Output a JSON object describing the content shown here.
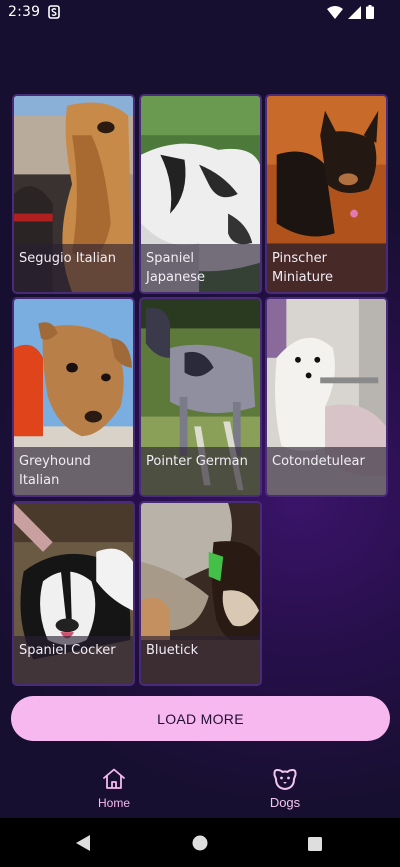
{
  "status_bar": {
    "time": "2:39",
    "icons": [
      "notification-s-icon",
      "wifi-icon",
      "cell-signal-icon",
      "battery-icon"
    ]
  },
  "dogs": [
    {
      "name": "Segugio Italian"
    },
    {
      "name": "Spaniel Japanese"
    },
    {
      "name": "Pinscher Miniature"
    },
    {
      "name": "Greyhound Italian"
    },
    {
      "name": "Pointer German"
    },
    {
      "name": "Cotondetulear"
    },
    {
      "name": "Spaniel Cocker"
    },
    {
      "name": "Bluetick"
    }
  ],
  "load_more_label": "LOAD MORE",
  "nav": {
    "home_label": "Home",
    "dogs_label": "Dogs"
  },
  "colors": {
    "accent": "#f7b8f0",
    "background": "#170f30",
    "gradient": "#3b146a"
  }
}
